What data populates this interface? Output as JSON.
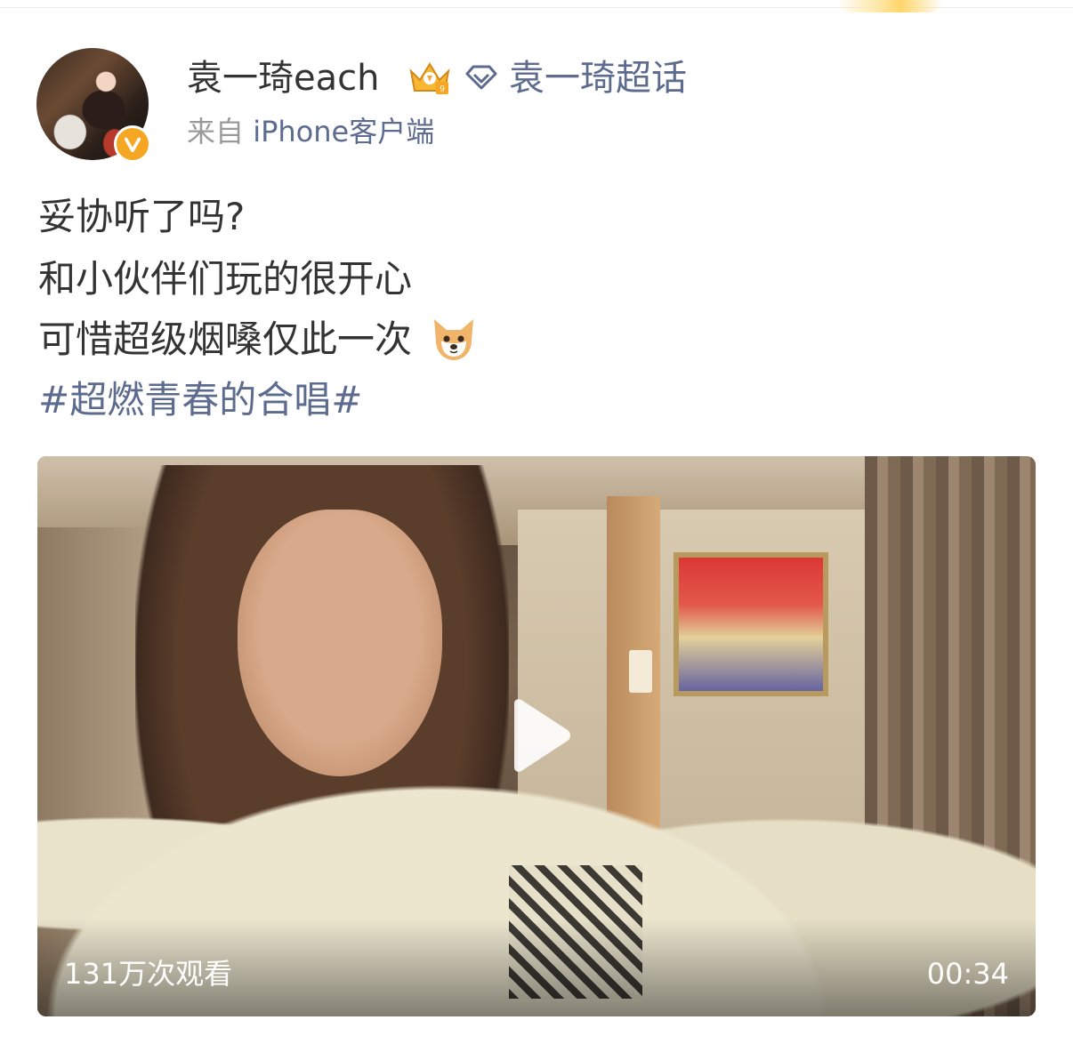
{
  "header": {
    "username": "袁一琦each",
    "supertopic": "袁一琦超话",
    "source_prefix": "来自",
    "source_device": "iPhone客户端"
  },
  "post": {
    "lines": [
      "妥协听了吗?",
      "和小伙伴们玩的很开心",
      "可惜超级烟嗓仅此一次"
    ],
    "hashtag": "#超燃青春的合唱#"
  },
  "video": {
    "views": "131万次观看",
    "duration": "00:34"
  },
  "icons": {
    "verified": "verified-v-icon",
    "crown": "crown-level-icon",
    "diamond": "diamond-supertopic-icon",
    "emoji": "dog-emoji-icon",
    "play": "play-icon"
  },
  "colors": {
    "link": "#5d6b8e",
    "text": "#333333",
    "meta": "#9a9a9a",
    "badge": "#f5a623"
  }
}
